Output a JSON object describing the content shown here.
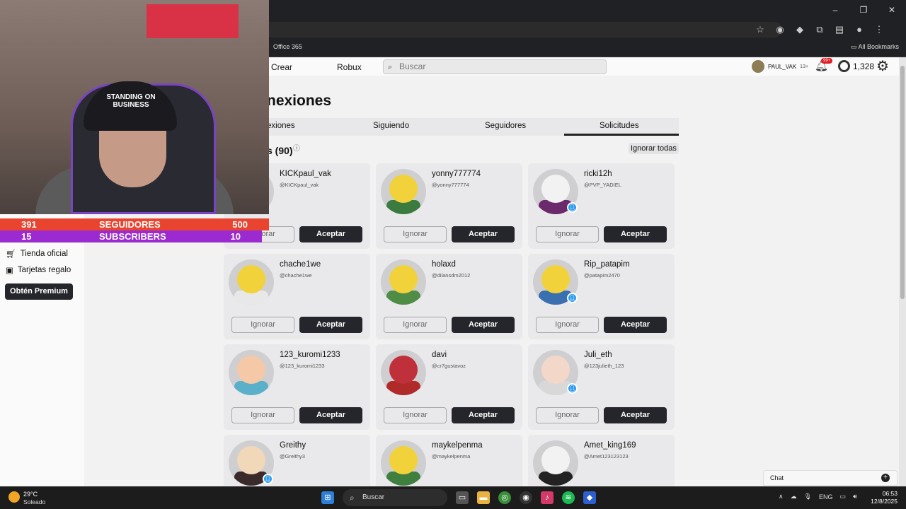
{
  "browser": {
    "window_controls": [
      "–",
      "❐",
      "✕"
    ],
    "bookmarks": {
      "office": "Office 365",
      "all_bookmarks": "All Bookmarks"
    }
  },
  "topnav": {
    "crear": "Crear",
    "robux": "Robux",
    "search_placeholder": "Buscar",
    "username": "PAUL_VAK",
    "age": "13+",
    "notif_badge": "99+",
    "robux_count": "1,328"
  },
  "page": {
    "heading": "nexiones",
    "tabs": [
      "exiones",
      "Siguiendo",
      "Seguidores",
      "Solicitudes"
    ],
    "active_tab_index": 3,
    "count_label": "s (90)",
    "ignore_all": "Ignorar todas"
  },
  "buttons": {
    "ignore": "Ignorar",
    "accept": "Aceptar"
  },
  "requests": [
    {
      "name": "KICKpaul_vak",
      "handle": "@KICKpaul_vak",
      "verified": false,
      "face": "#cfcfd1",
      "body": "#cfcfd1"
    },
    {
      "name": "yonny777774",
      "handle": "@yonny777774",
      "verified": false,
      "face": "#f1d23a",
      "body": "#3c7b3f"
    },
    {
      "name": "ricki12h",
      "handle": "@PVP_YADIEL",
      "verified": true,
      "face": "#f2f2f2",
      "body": "#6b2a6b"
    },
    {
      "name": "chache1we",
      "handle": "@chache1we",
      "verified": false,
      "face": "#f1d23a",
      "body": "#e8e8e8"
    },
    {
      "name": "holaxd",
      "handle": "@dilansdm2012",
      "verified": false,
      "face": "#f1d23a",
      "body": "#4f8d46"
    },
    {
      "name": "Rip_patapim",
      "handle": "@patapim2470",
      "verified": true,
      "face": "#f1d23a",
      "body": "#3a6fb0"
    },
    {
      "name": "123_kuromi1233",
      "handle": "@123_kuromi1233",
      "verified": false,
      "face": "#f5c8a8",
      "body": "#5ab0c8"
    },
    {
      "name": "davi",
      "handle": "@cr7gustavoz",
      "verified": false,
      "face": "#c0303a",
      "body": "#b02a2a"
    },
    {
      "name": "Juli_eth",
      "handle": "@123julieth_123",
      "verified": true,
      "face": "#f3d7c8",
      "body": "#d8d8d8"
    },
    {
      "name": "Greithy",
      "handle": "@Greithy3",
      "verified": true,
      "face": "#f0d8b8",
      "body": "#3a2a2a"
    },
    {
      "name": "maykelpenma",
      "handle": "@maykelpenma",
      "verified": false,
      "face": "#f1d23a",
      "body": "#3f7f3f"
    },
    {
      "name": "Amet_king169",
      "handle": "@Amet123123123",
      "verified": false,
      "face": "#f2f2f2",
      "body": "#222"
    }
  ],
  "sidebar": {
    "tienda": "Tienda oficial",
    "tarjetas": "Tarjetas regalo",
    "premium": "Obtén Premium"
  },
  "chat": {
    "label": "Chat"
  },
  "webcam": {
    "cap_text": "STANDING ON BUSINESS",
    "followers_current": "391",
    "followers_label": "SEGUIDORES",
    "followers_goal": "500",
    "subs_current": "15",
    "subs_label": "SUBSCRIBERS",
    "subs_goal": "10"
  },
  "taskbar": {
    "temp": "29°C",
    "condition": "Soleado",
    "search": "Buscar",
    "lang": "ENG",
    "time": "06:53",
    "date": "12/8/2025"
  },
  "colors": {
    "accent_dark": "#25262b",
    "page_bg": "#f2f2f3",
    "verified": "#2d9bf0"
  }
}
